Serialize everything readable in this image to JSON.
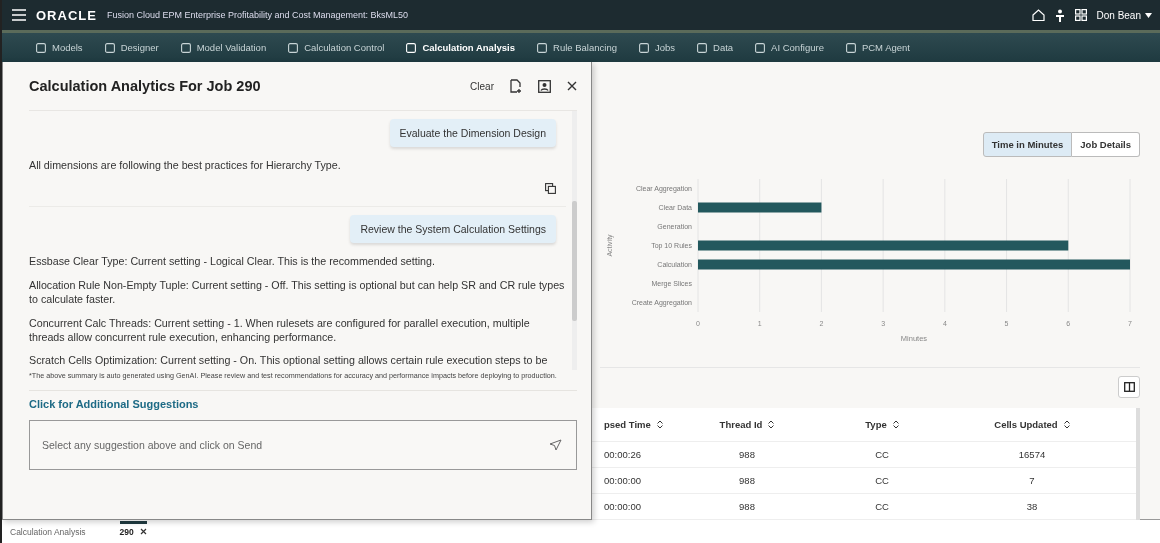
{
  "header": {
    "logo": "ORACLE",
    "app_title": "Fusion Cloud EPM Enterprise Profitability and Cost Management: BksML50",
    "user": "Don Bean"
  },
  "nav": [
    {
      "label": "Models",
      "selected": false
    },
    {
      "label": "Designer",
      "selected": false
    },
    {
      "label": "Model Validation",
      "selected": false
    },
    {
      "label": "Calculation Control",
      "selected": false
    },
    {
      "label": "Calculation Analysis",
      "selected": true
    },
    {
      "label": "Rule Balancing",
      "selected": false
    },
    {
      "label": "Jobs",
      "selected": false
    },
    {
      "label": "Data",
      "selected": false
    },
    {
      "label": "AI Configure",
      "selected": false
    },
    {
      "label": "PCM Agent",
      "selected": false
    }
  ],
  "panel": {
    "title": "Calculation Analytics For Job 290",
    "clear": "Clear",
    "messages": [
      {
        "kind": "prompt",
        "text": "Evaluate the Dimension Design"
      },
      {
        "kind": "answer",
        "paragraphs": [
          "All dimensions are following the best practices for Hierarchy Type."
        ]
      },
      {
        "kind": "prompt",
        "text": "Review the System Calculation Settings"
      },
      {
        "kind": "answer",
        "paragraphs": [
          "Essbase Clear Type: Current setting - Logical Clear. This is the recommended setting.",
          "Allocation Rule Non-Empty Tuple: Current setting - Off. This setting is optional but can help SR and CR rule types to calculate faster.",
          "Concurrent Calc Threads: Current setting - 1. When rulesets are configured for parallel execution, multiple threads allow concurrent rule execution, enhancing performance.",
          "Scratch Cells Optimization: Current setting - On. This optional setting allows certain rule execution steps to be"
        ]
      }
    ],
    "disclaimer": "*The above summary is auto generated using GenAI. Please review and test recommendations for accuracy and performance impacts before deploying to production.",
    "link": "Click for Additional Suggestions",
    "input": {
      "placeholder": "Select any suggestion above and click on Send"
    }
  },
  "view_toggle": [
    {
      "label": "Time in Minutes",
      "selected": true
    },
    {
      "label": "Job Details",
      "selected": false
    }
  ],
  "chart_data": {
    "type": "bar",
    "orientation": "horizontal",
    "xlabel": "Minutes",
    "ylabel": "Activity",
    "categories": [
      "Clear Aggregation",
      "Clear Data",
      "Generation",
      "Top 10 Rules",
      "Calculation",
      "Merge Slices",
      "Create Aggregation"
    ],
    "series": [
      {
        "color": "#23585d",
        "values": [
          0,
          2,
          0,
          6,
          7,
          0,
          0
        ]
      }
    ],
    "grid": true,
    "xlim": [
      0,
      7
    ],
    "xticks": [
      0,
      1,
      2,
      3,
      4,
      5,
      6,
      7
    ]
  },
  "table": {
    "columns": [
      "psed Time",
      "Thread Id",
      "Type",
      "Cells Updated"
    ],
    "rows": [
      [
        "00:00:26",
        "988",
        "CC",
        "16574"
      ],
      [
        "00:00:00",
        "988",
        "CC",
        "7"
      ],
      [
        "00:00:00",
        "988",
        "CC",
        "38"
      ]
    ]
  },
  "bottom_tabs": [
    {
      "label": "Calculation Analysis",
      "closable": false,
      "selected": false
    },
    {
      "label": "290",
      "closable": true,
      "selected": true
    }
  ]
}
